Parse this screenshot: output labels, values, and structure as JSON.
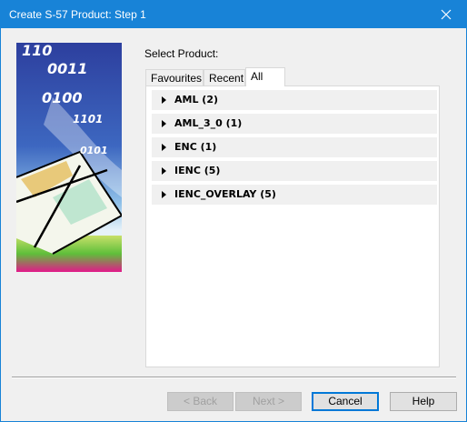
{
  "window": {
    "title": "Create S-57 Product: Step 1"
  },
  "banner": {
    "digits": [
      "110",
      "0011",
      "0100",
      "1101",
      "0101"
    ]
  },
  "select_label": "Select Product:",
  "tabs": [
    {
      "label": "Favourites",
      "active": false
    },
    {
      "label": "Recent",
      "active": false
    },
    {
      "label": "All",
      "active": true
    }
  ],
  "groups": [
    {
      "label": "AML (2)"
    },
    {
      "label": "AML_3_0 (1)"
    },
    {
      "label": "ENC (1)"
    },
    {
      "label": "IENC (5)"
    },
    {
      "label": "IENC_OVERLAY (5)"
    }
  ],
  "buttons": {
    "back": "< Back",
    "next": "Next >",
    "cancel": "Cancel",
    "help": "Help"
  },
  "colors": {
    "titlebar": "#1883d7",
    "default_button_border": "#0078d7"
  }
}
